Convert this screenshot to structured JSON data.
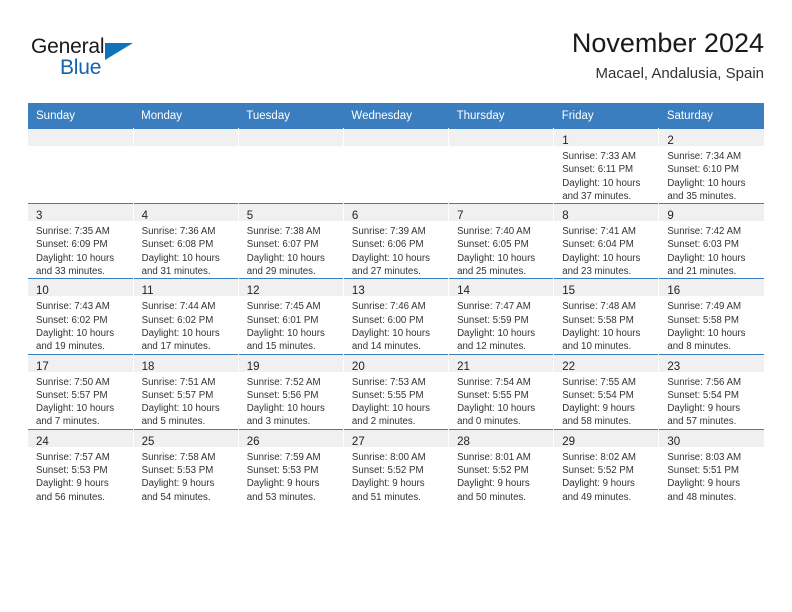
{
  "brand": {
    "name_part1": "General",
    "name_part2": "Blue",
    "accent_color": "#1072bb"
  },
  "header": {
    "title": "November 2024",
    "subtitle": "Macael, Andalusia, Spain"
  },
  "calendar": {
    "header_bg": "#3a7ebf",
    "daynum_bg": "#f0f0f0",
    "weekday_headers": [
      "Sunday",
      "Monday",
      "Tuesday",
      "Wednesday",
      "Thursday",
      "Friday",
      "Saturday"
    ],
    "weeks": [
      [
        {
          "day": "",
          "sunrise": "",
          "sunset": "",
          "daylight1": "",
          "daylight2": "",
          "empty": true
        },
        {
          "day": "",
          "sunrise": "",
          "sunset": "",
          "daylight1": "",
          "daylight2": "",
          "empty": true
        },
        {
          "day": "",
          "sunrise": "",
          "sunset": "",
          "daylight1": "",
          "daylight2": "",
          "empty": true
        },
        {
          "day": "",
          "sunrise": "",
          "sunset": "",
          "daylight1": "",
          "daylight2": "",
          "empty": true
        },
        {
          "day": "",
          "sunrise": "",
          "sunset": "",
          "daylight1": "",
          "daylight2": "",
          "empty": true
        },
        {
          "day": "1",
          "sunrise": "Sunrise: 7:33 AM",
          "sunset": "Sunset: 6:11 PM",
          "daylight1": "Daylight: 10 hours",
          "daylight2": "and 37 minutes."
        },
        {
          "day": "2",
          "sunrise": "Sunrise: 7:34 AM",
          "sunset": "Sunset: 6:10 PM",
          "daylight1": "Daylight: 10 hours",
          "daylight2": "and 35 minutes."
        }
      ],
      [
        {
          "day": "3",
          "sunrise": "Sunrise: 7:35 AM",
          "sunset": "Sunset: 6:09 PM",
          "daylight1": "Daylight: 10 hours",
          "daylight2": "and 33 minutes."
        },
        {
          "day": "4",
          "sunrise": "Sunrise: 7:36 AM",
          "sunset": "Sunset: 6:08 PM",
          "daylight1": "Daylight: 10 hours",
          "daylight2": "and 31 minutes."
        },
        {
          "day": "5",
          "sunrise": "Sunrise: 7:38 AM",
          "sunset": "Sunset: 6:07 PM",
          "daylight1": "Daylight: 10 hours",
          "daylight2": "and 29 minutes."
        },
        {
          "day": "6",
          "sunrise": "Sunrise: 7:39 AM",
          "sunset": "Sunset: 6:06 PM",
          "daylight1": "Daylight: 10 hours",
          "daylight2": "and 27 minutes."
        },
        {
          "day": "7",
          "sunrise": "Sunrise: 7:40 AM",
          "sunset": "Sunset: 6:05 PM",
          "daylight1": "Daylight: 10 hours",
          "daylight2": "and 25 minutes."
        },
        {
          "day": "8",
          "sunrise": "Sunrise: 7:41 AM",
          "sunset": "Sunset: 6:04 PM",
          "daylight1": "Daylight: 10 hours",
          "daylight2": "and 23 minutes."
        },
        {
          "day": "9",
          "sunrise": "Sunrise: 7:42 AM",
          "sunset": "Sunset: 6:03 PM",
          "daylight1": "Daylight: 10 hours",
          "daylight2": "and 21 minutes."
        }
      ],
      [
        {
          "day": "10",
          "sunrise": "Sunrise: 7:43 AM",
          "sunset": "Sunset: 6:02 PM",
          "daylight1": "Daylight: 10 hours",
          "daylight2": "and 19 minutes."
        },
        {
          "day": "11",
          "sunrise": "Sunrise: 7:44 AM",
          "sunset": "Sunset: 6:02 PM",
          "daylight1": "Daylight: 10 hours",
          "daylight2": "and 17 minutes."
        },
        {
          "day": "12",
          "sunrise": "Sunrise: 7:45 AM",
          "sunset": "Sunset: 6:01 PM",
          "daylight1": "Daylight: 10 hours",
          "daylight2": "and 15 minutes."
        },
        {
          "day": "13",
          "sunrise": "Sunrise: 7:46 AM",
          "sunset": "Sunset: 6:00 PM",
          "daylight1": "Daylight: 10 hours",
          "daylight2": "and 14 minutes."
        },
        {
          "day": "14",
          "sunrise": "Sunrise: 7:47 AM",
          "sunset": "Sunset: 5:59 PM",
          "daylight1": "Daylight: 10 hours",
          "daylight2": "and 12 minutes."
        },
        {
          "day": "15",
          "sunrise": "Sunrise: 7:48 AM",
          "sunset": "Sunset: 5:58 PM",
          "daylight1": "Daylight: 10 hours",
          "daylight2": "and 10 minutes."
        },
        {
          "day": "16",
          "sunrise": "Sunrise: 7:49 AM",
          "sunset": "Sunset: 5:58 PM",
          "daylight1": "Daylight: 10 hours",
          "daylight2": "and 8 minutes."
        }
      ],
      [
        {
          "day": "17",
          "sunrise": "Sunrise: 7:50 AM",
          "sunset": "Sunset: 5:57 PM",
          "daylight1": "Daylight: 10 hours",
          "daylight2": "and 7 minutes."
        },
        {
          "day": "18",
          "sunrise": "Sunrise: 7:51 AM",
          "sunset": "Sunset: 5:57 PM",
          "daylight1": "Daylight: 10 hours",
          "daylight2": "and 5 minutes."
        },
        {
          "day": "19",
          "sunrise": "Sunrise: 7:52 AM",
          "sunset": "Sunset: 5:56 PM",
          "daylight1": "Daylight: 10 hours",
          "daylight2": "and 3 minutes."
        },
        {
          "day": "20",
          "sunrise": "Sunrise: 7:53 AM",
          "sunset": "Sunset: 5:55 PM",
          "daylight1": "Daylight: 10 hours",
          "daylight2": "and 2 minutes."
        },
        {
          "day": "21",
          "sunrise": "Sunrise: 7:54 AM",
          "sunset": "Sunset: 5:55 PM",
          "daylight1": "Daylight: 10 hours",
          "daylight2": "and 0 minutes."
        },
        {
          "day": "22",
          "sunrise": "Sunrise: 7:55 AM",
          "sunset": "Sunset: 5:54 PM",
          "daylight1": "Daylight: 9 hours",
          "daylight2": "and 58 minutes."
        },
        {
          "day": "23",
          "sunrise": "Sunrise: 7:56 AM",
          "sunset": "Sunset: 5:54 PM",
          "daylight1": "Daylight: 9 hours",
          "daylight2": "and 57 minutes."
        }
      ],
      [
        {
          "day": "24",
          "sunrise": "Sunrise: 7:57 AM",
          "sunset": "Sunset: 5:53 PM",
          "daylight1": "Daylight: 9 hours",
          "daylight2": "and 56 minutes."
        },
        {
          "day": "25",
          "sunrise": "Sunrise: 7:58 AM",
          "sunset": "Sunset: 5:53 PM",
          "daylight1": "Daylight: 9 hours",
          "daylight2": "and 54 minutes."
        },
        {
          "day": "26",
          "sunrise": "Sunrise: 7:59 AM",
          "sunset": "Sunset: 5:53 PM",
          "daylight1": "Daylight: 9 hours",
          "daylight2": "and 53 minutes."
        },
        {
          "day": "27",
          "sunrise": "Sunrise: 8:00 AM",
          "sunset": "Sunset: 5:52 PM",
          "daylight1": "Daylight: 9 hours",
          "daylight2": "and 51 minutes."
        },
        {
          "day": "28",
          "sunrise": "Sunrise: 8:01 AM",
          "sunset": "Sunset: 5:52 PM",
          "daylight1": "Daylight: 9 hours",
          "daylight2": "and 50 minutes."
        },
        {
          "day": "29",
          "sunrise": "Sunrise: 8:02 AM",
          "sunset": "Sunset: 5:52 PM",
          "daylight1": "Daylight: 9 hours",
          "daylight2": "and 49 minutes."
        },
        {
          "day": "30",
          "sunrise": "Sunrise: 8:03 AM",
          "sunset": "Sunset: 5:51 PM",
          "daylight1": "Daylight: 9 hours",
          "daylight2": "and 48 minutes."
        }
      ]
    ]
  }
}
